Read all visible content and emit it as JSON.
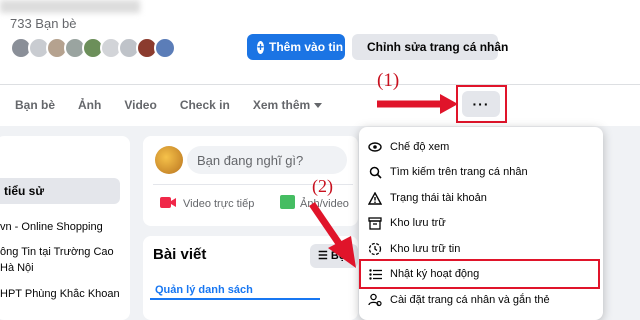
{
  "profile": {
    "friends_count": "733 Bạn bè"
  },
  "actions": {
    "add_story": "Thêm vào tin",
    "edit_profile": "Chỉnh sửa trang cá nhân"
  },
  "tabs": [
    {
      "label": "Bạn bè"
    },
    {
      "label": "Ảnh"
    },
    {
      "label": "Video"
    },
    {
      "label": "Check in"
    },
    {
      "label": "Xem thêm"
    }
  ],
  "more_button": {
    "label": "···"
  },
  "annotations": {
    "step1": "(1)",
    "step2": "(2)",
    "highlight_color": "#e0142a"
  },
  "left": {
    "intro_item": "tiểu sử",
    "line1": "vn - Online Shopping",
    "line2": "ông Tin tại Trường Cao",
    "line3": "Hà Nội",
    "line4": "HPT Phùng Khắc Khoan"
  },
  "composer": {
    "placeholder": "Bạn đang nghĩ gì?",
    "live_video": "Video trực tiếp",
    "photo_video": "Ảnh/video"
  },
  "posts": {
    "title": "Bài viết",
    "filter": "Bộ",
    "list_view": "Quản lý danh sách"
  },
  "menu": {
    "items": [
      {
        "label": "Chế độ xem",
        "icon": "eye-icon"
      },
      {
        "label": "Tìm kiếm trên trang cá nhân",
        "icon": "search-icon"
      },
      {
        "label": "Trạng thái tài khoản",
        "icon": "warning-icon"
      },
      {
        "label": "Kho lưu trữ",
        "icon": "archive-icon"
      },
      {
        "label": "Kho lưu trữ tin",
        "icon": "history-icon"
      },
      {
        "label": "Nhật ký hoạt động",
        "icon": "list-icon"
      },
      {
        "label": "Cài đặt trang cá nhân và gắn thẻ",
        "icon": "profile-settings-icon"
      }
    ]
  },
  "colors": {
    "primary": "#1b74e4",
    "secondary": "#e4e6eb",
    "annotation": "#e0142a"
  }
}
